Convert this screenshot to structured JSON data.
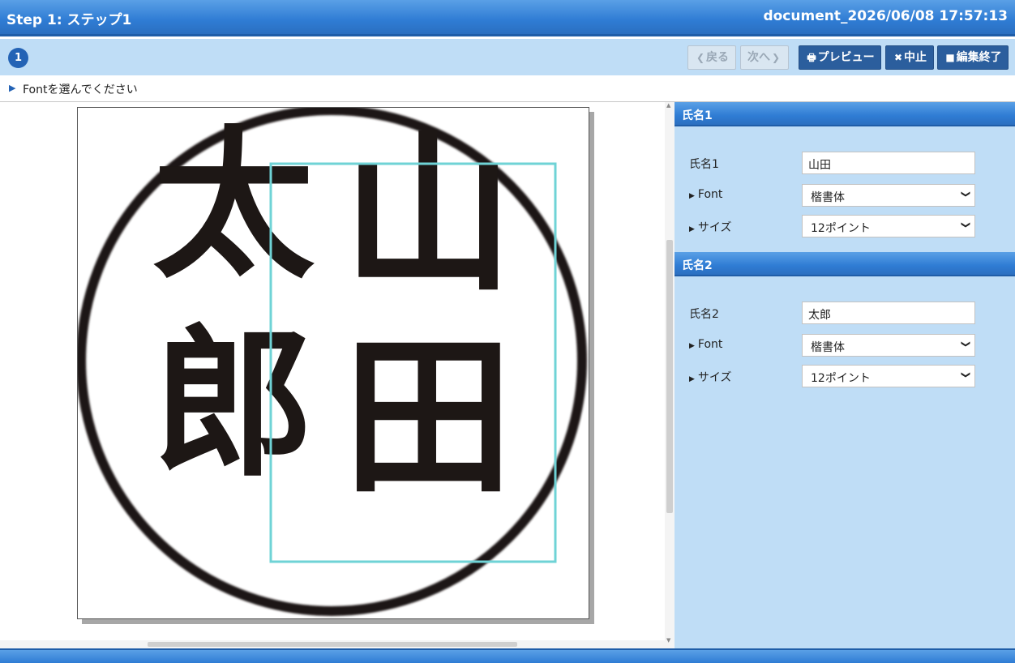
{
  "header": {
    "title": "Step 1: ステップ1",
    "document": "document_2026/06/08 17:57:13"
  },
  "toolbar": {
    "step_number": "1",
    "back_label": "戻る",
    "next_label": "次へ",
    "preview_label": "プレビュー",
    "cancel_label": "中止",
    "finish_label": "編集終了"
  },
  "hint": {
    "text": "Fontを選んでください"
  },
  "stamp": {
    "char1": "太",
    "char2": "郎",
    "char3": "山",
    "char4": "田",
    "ink_color": "#1d1715",
    "selection_color": "#6fd3d6"
  },
  "panel": {
    "section1": {
      "header": "氏名1",
      "name_label": "氏名1",
      "name_value": "山田",
      "font_label": "Font",
      "font_value": "楷書体",
      "size_label": "サイズ",
      "size_value": "12ポイント"
    },
    "section2": {
      "header": "氏名2",
      "name_label": "氏名2",
      "name_value": "太郎",
      "font_label": "Font",
      "font_value": "楷書体",
      "size_label": "サイズ",
      "size_value": "12ポイント"
    }
  },
  "colors": {
    "header_blue": "#2f7cd4",
    "panel_bg": "#bfddf6",
    "button_dark": "#2b5e9d"
  }
}
